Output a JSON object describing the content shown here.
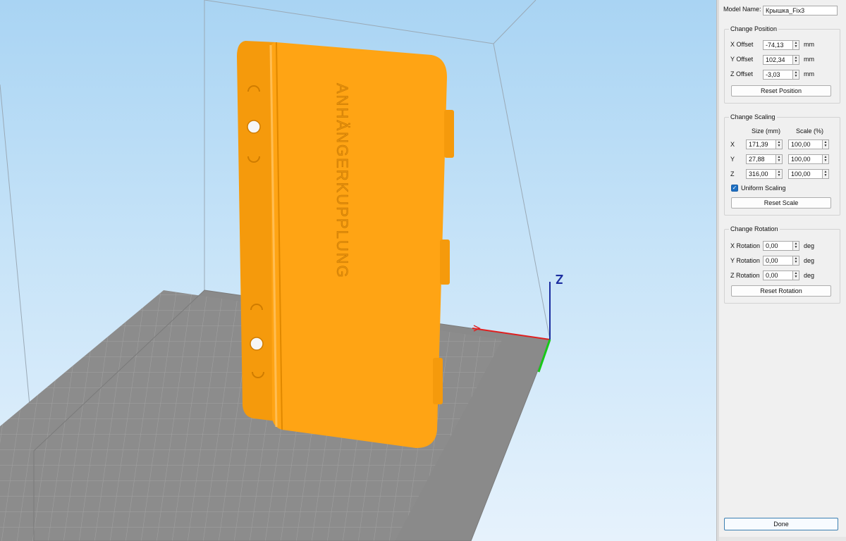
{
  "model": {
    "label": "Model Name:",
    "value": "Крышка_Fix3"
  },
  "position": {
    "title": "Change Position",
    "unit": "mm",
    "rows": [
      {
        "label": "X Offset",
        "value": "-74,13"
      },
      {
        "label": "Y Offset",
        "value": "102,34"
      },
      {
        "label": "Z Offset",
        "value": "-3,03"
      }
    ],
    "reset_label": "Reset Position"
  },
  "scaling": {
    "title": "Change Scaling",
    "size_header": "Size (mm)",
    "scale_header": "Scale (%)",
    "rows": [
      {
        "axis": "X",
        "size": "171,39",
        "scale": "100,00"
      },
      {
        "axis": "Y",
        "size": "27,88",
        "scale": "100,00"
      },
      {
        "axis": "Z",
        "size": "316,00",
        "scale": "100,00"
      }
    ],
    "uniform_label": "Uniform Scaling",
    "uniform_checked": true,
    "reset_label": "Reset Scale"
  },
  "rotation": {
    "title": "Change Rotation",
    "unit": "deg",
    "rows": [
      {
        "label": "X Rotation",
        "value": "0,00"
      },
      {
        "label": "Y Rotation",
        "value": "0,00"
      },
      {
        "label": "Z Rotation",
        "value": "0,00"
      }
    ],
    "reset_label": "Reset Rotation"
  },
  "done_label": "Done",
  "viewport": {
    "model_text": "ANHÄNGERKUPPLUNG",
    "axis_label": "Z",
    "colors": {
      "model": "#ffa310",
      "bed": "#8a8a8a",
      "x_axis": "#e02020",
      "y_axis": "#18c818",
      "z_axis": "#1c2ea0"
    }
  }
}
